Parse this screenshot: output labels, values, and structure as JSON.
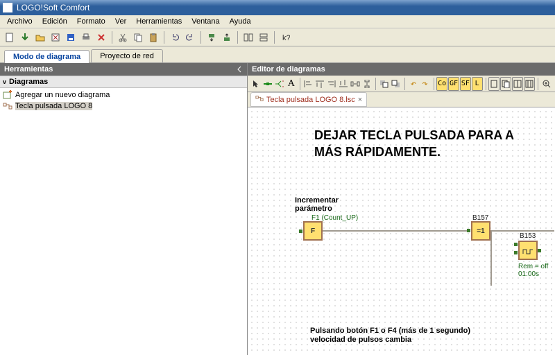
{
  "window": {
    "title": "LOGO!Soft Comfort"
  },
  "menu": [
    "Archivo",
    "Edición",
    "Formato",
    "Ver",
    "Herramientas",
    "Ventana",
    "Ayuda"
  ],
  "mode_tabs": {
    "active": "Modo de diagrama",
    "inactive": "Proyecto de red"
  },
  "left_panel": {
    "header": "Herramientas",
    "section": "Diagramas",
    "items": [
      {
        "label": "Agregar un nuevo diagrama"
      },
      {
        "label": "Tecla pulsada LOGO 8"
      }
    ]
  },
  "editor_header": "Editor de diagramas",
  "editor_badges": [
    "Co",
    "GF",
    "SF",
    "L"
  ],
  "file_tab": {
    "name": "Tecla pulsada LOGO 8.lsc"
  },
  "canvas": {
    "title_line1": "DEJAR TECLA PULSADA PARA A",
    "title_line2": "MÁS RÁPIDAMENTE.",
    "label_incr1": "Incrementar",
    "label_incr2": "parámetro",
    "f1_hint": "F1 (Count_UP)",
    "blk_f": "F",
    "blk_b157_name": "B157",
    "blk_b157_val": "=1",
    "blk_b153_name": "B153",
    "blk_b153_rem1": "Rem = off",
    "blk_b153_rem2": "01:00s",
    "note1": "Pulsando botón F1 o F4 (más de 1 segundo)",
    "note2": "velocidad de pulsos cambia"
  }
}
